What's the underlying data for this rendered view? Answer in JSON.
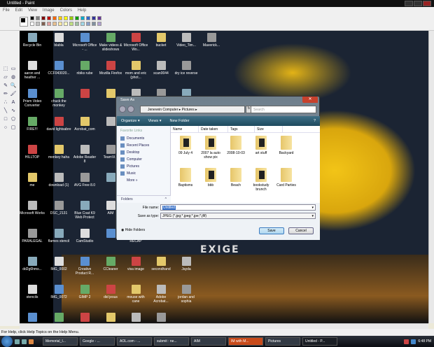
{
  "window": {
    "title": "Untitled - Paint"
  },
  "menu": [
    "File",
    "Edit",
    "View",
    "Image",
    "Colors",
    "Help"
  ],
  "palette": {
    "top": [
      "#000000",
      "#808080",
      "#800000",
      "#c00000",
      "#ff6600",
      "#ffcc00",
      "#ffff00",
      "#99cc00",
      "#00a000",
      "#00aacc",
      "#3366cc",
      "#333399",
      "#663399"
    ],
    "bottom": [
      "#ffffff",
      "#c0c0c0",
      "#806050",
      "#e0a0a0",
      "#e8c090",
      "#ffe8a0",
      "#ffffc0",
      "#c0e080",
      "#a0c0a0",
      "#a0d8e8",
      "#8aa0c8",
      "#8090a0",
      "#b0a0d0"
    ]
  },
  "tools": [
    "free-select",
    "select",
    "eraser",
    "fill",
    "pick-color",
    "magnifier",
    "pencil",
    "brush",
    "airbrush",
    "text",
    "line",
    "curve",
    "rectangle",
    "polygon",
    "ellipse",
    "rounded-rectangle"
  ],
  "desktop": {
    "columns": [
      [
        "Recycle Bin",
        "aaron and heather ...",
        "Prism Video Converter",
        "FIRE!!!",
        "HILLTOP",
        "me",
        "Microsoft Works",
        "PARALEGAL",
        "dd2g6hms...",
        "stencils",
        ""
      ],
      [
        "blabla",
        "CCF043020...",
        "chuck the monkey",
        "david lightsabre",
        "monkey haha",
        "download (1)",
        "DSC_2131",
        "flames stencil",
        "IMG_0002",
        "IMG_0072",
        ""
      ],
      [
        "Microsoft Office - ...",
        "nbiks rube",
        "",
        "Acrobat_com",
        "Adobe Reader 8",
        "AVG Free 8.0",
        "Blue Coat K9 Web Protect",
        "CamStudio",
        "Creative Product R...",
        "GIMP 2",
        ""
      ],
      [
        "Make videos & slideshows",
        "Mozilla Firefox",
        "",
        "",
        "TeamVi...",
        "",
        "AIM",
        "",
        "CCleaner",
        "did jesus",
        ""
      ],
      [
        "Microsoft Office Wo...",
        "mom and eric (phot...",
        "",
        "",
        "",
        "",
        "",
        "RECAP",
        "visa image",
        "mouse with cane",
        ""
      ],
      [
        "bucket",
        "scan0044",
        "",
        "",
        "",
        "",
        "",
        "",
        "secondhand",
        "Adobe Acrobat...",
        ""
      ],
      [
        "Video_Tim...",
        "dry ice reverse",
        "",
        "",
        "",
        "",
        "",
        "",
        "Jayda",
        "jordan and sophia"
      ],
      [
        "Maverick..."
      ]
    ]
  },
  "canvas_logo": "EXIGE",
  "status": "For Help, click Help Topics on the Help Menu.",
  "taskbar": {
    "items": [
      "Memorial_I...",
      "Google - ...",
      "AOL.com - ...",
      "submit : ne...",
      "AIM",
      "IM with M...",
      "Pictures",
      "Untitled - P..."
    ],
    "clock": "6:48 PM"
  },
  "dialog": {
    "title": "Save As",
    "address": "Jenevein Computer ▸ Pictures ▸",
    "search_placeholder": "Search",
    "toolbar": {
      "organize": "Organize ▾",
      "views": "Views ▾",
      "new_folder": "New Folder",
      "help": "?"
    },
    "favorites_header": "Favorite Links",
    "favorites": [
      "Documents",
      "Recent Places",
      "Desktop",
      "Computer",
      "Pictures",
      "Music"
    ],
    "more": "More »",
    "folders": "Folders",
    "columns": [
      "Name",
      "Date taken",
      "Tags",
      "Size"
    ],
    "files": [
      {
        "name": "09 July 4",
        "photo": true
      },
      {
        "name": "2007 la auto show pix",
        "photo": true
      },
      {
        "name": "2008-10-03",
        "photo": false
      },
      {
        "name": "art stuff",
        "photo": true
      },
      {
        "name": "Backyard",
        "photo": false
      },
      {
        "name": "Baptisms",
        "photo": false
      },
      {
        "name": "bbb",
        "photo": true
      },
      {
        "name": "Beach",
        "photo": false
      },
      {
        "name": "bookstudy brunch",
        "photo": true
      },
      {
        "name": "Card Parties",
        "photo": false
      }
    ],
    "file_name_label": "File name:",
    "file_name_value": "Untitled",
    "type_label": "Save as type:",
    "type_value": "JPEG (*.jpg;*.jpeg;*.jpe;*.jfif)",
    "hide_folders": "Hide Folders",
    "save": "Save",
    "cancel": "Cancel"
  }
}
